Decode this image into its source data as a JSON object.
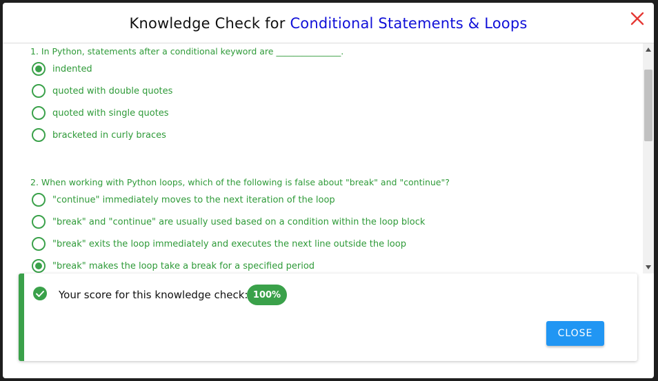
{
  "header": {
    "title_prefix": "Knowledge Check for ",
    "title_topic": "Conditional Statements & Loops"
  },
  "questions": [
    {
      "text": "1. In Python, statements after a conditional keyword are _______________.",
      "options": [
        {
          "label": "indented",
          "selected": true
        },
        {
          "label": "quoted with double quotes",
          "selected": false
        },
        {
          "label": "quoted with single quotes",
          "selected": false
        },
        {
          "label": "bracketed in curly braces",
          "selected": false
        }
      ]
    },
    {
      "text": "2. When working with Python loops, which of the following is false about \"break\" and \"continue\"?",
      "options": [
        {
          "label": "\"continue\" immediately moves to the next iteration of the loop",
          "selected": false
        },
        {
          "label": "\"break\" and \"continue\" are usually used based on a condition within the loop block",
          "selected": false
        },
        {
          "label": "\"break\" exits the loop immediately and executes the next line outside the loop",
          "selected": false
        },
        {
          "label": "\"break\" makes the loop take a break for a specified period",
          "selected": true
        }
      ]
    }
  ],
  "result": {
    "score_text": "Your score for this knowledge check:",
    "score_value": "100%",
    "close_label": "CLOSE"
  },
  "colors": {
    "accent_green": "#3aa14a",
    "title_blue": "#1010d8",
    "button_blue": "#2196f3",
    "close_red": "#e53935"
  }
}
